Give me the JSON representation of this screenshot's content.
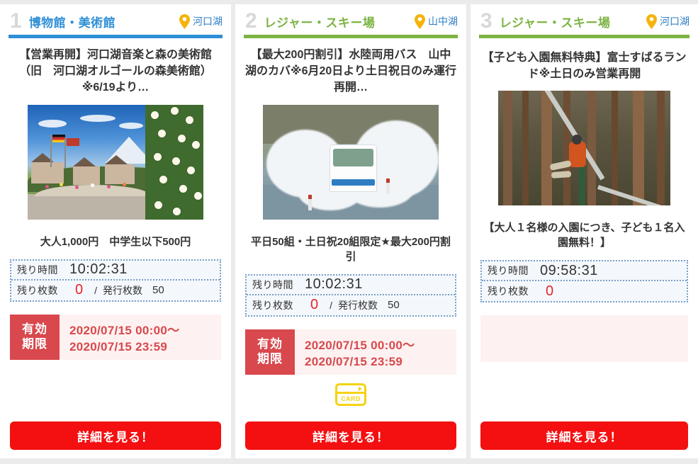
{
  "cards": [
    {
      "rank": "1",
      "category": "博物館・美術館",
      "accent": "#2f8fd6",
      "spot": "河口湖",
      "pin_icon": "map-pin-icon",
      "title": "【営業再開】河口湖音楽と森の美術館（旧　河口湖オルゴールの森美術館）※6/19より…",
      "image_alt": "欧風の街並みと富士山とバラ",
      "desc": "大人1,000円　中学生以下500円",
      "ticket": {
        "time_label": "残り時間",
        "time_value": "10:02:31",
        "left_label": "残り枚数",
        "left_value": "0",
        "separator": "/",
        "issued_label": "発行枚数",
        "issued_value": "50"
      },
      "validity": {
        "label_line1": "有効",
        "label_line2": "期限",
        "start": "2020/07/15 00:00〜",
        "end": "2020/07/15 23:59"
      },
      "has_card_icon": false,
      "card_icon_label": "CARD",
      "button_label": "詳細を見る！"
    },
    {
      "rank": "2",
      "category": "レジャー・スキー場",
      "accent": "#7cb342",
      "spot": "山中湖",
      "pin_icon": "map-pin-icon",
      "title": "【最大200円割引】水陸両用バス　山中湖のカバ※6月20日より土日祝日のみ運行再開…",
      "image_alt": "水しぶきをあげる水陸両用バス",
      "desc": "平日50組・土日祝20組限定★最大200円割引",
      "ticket": {
        "time_label": "残り時間",
        "time_value": "10:02:31",
        "left_label": "残り枚数",
        "left_value": "0",
        "separator": "/",
        "issued_label": "発行枚数",
        "issued_value": "50"
      },
      "validity": {
        "label_line1": "有効",
        "label_line2": "期限",
        "start": "2020/07/15 00:00〜",
        "end": "2020/07/15 23:59"
      },
      "has_card_icon": true,
      "card_icon_label": "CARD",
      "button_label": "詳細を見る！"
    },
    {
      "rank": "3",
      "category": "レジャー・スキー場",
      "accent": "#7cb342",
      "spot": "河口湖",
      "pin_icon": "map-pin-icon",
      "title": "【子ども入園無料特典】富士すばるランド※土日のみ営業再開",
      "image_alt": "森のジップラインを滑る人",
      "desc": "【大人１名様の入園につき、子ども１名入園無料！】",
      "ticket": {
        "time_label": "残り時間",
        "time_value": "09:58:31",
        "left_label": "残り枚数",
        "left_value": "0",
        "separator": "",
        "issued_label": "",
        "issued_value": ""
      },
      "validity": {
        "label_line1": "",
        "label_line2": "",
        "start": "",
        "end": ""
      },
      "has_card_icon": false,
      "card_icon_label": "CARD",
      "button_label": "詳細を見る！"
    }
  ]
}
